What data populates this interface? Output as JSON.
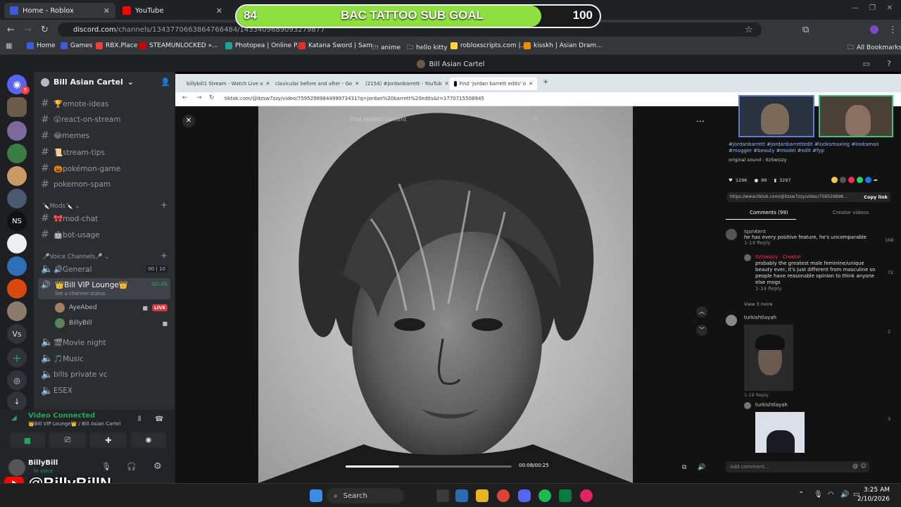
{
  "browser": {
    "tabs": [
      {
        "title": "Home - Roblox",
        "color": "#3b5bdb"
      },
      {
        "title": "YouTube",
        "color": "#ff0000"
      }
    ],
    "url_host": "discord.com",
    "url_path": "/channels/1343770663864766484/1433409689093279877",
    "bookmarks": [
      "Home",
      "Games",
      "RBX.Place",
      "STEAMUNLOCKED »...",
      "Photopea | Online P...",
      "Katana Sword | Sam...",
      "anime",
      "hello kitty",
      "robloxscripts.com |...",
      "kisskh | Asian Dram..."
    ],
    "all_bookmarks": "All Bookmarks"
  },
  "sub_goal": {
    "current": "84",
    "title": "BAC TATTOO SUB GOAL",
    "max": "100",
    "progress": 0.84,
    "color": "#8de040"
  },
  "discord": {
    "window_title": "Bill Asian Cartel",
    "server_name": "Bill Asian Cartel",
    "server_badge": "5",
    "channels": [
      {
        "name": "🏆emote-ideas"
      },
      {
        "name": "😮react-on-stream"
      },
      {
        "name": "😂memes"
      },
      {
        "name": "📜stream-tips"
      },
      {
        "name": "🎃pokémon-game"
      },
      {
        "name": "pokemon-spam"
      }
    ],
    "mods_category": "🔪Mods🔪",
    "mod_channels": [
      {
        "name": "🎀mod-chat"
      },
      {
        "name": "🤖bot-usage"
      }
    ],
    "voice_category": "🎤Voice Channels🎤",
    "voice_channels": {
      "general": "🔊General",
      "general_count_a": "00",
      "general_count_b": "10",
      "vip": "👑Bill VIP Lounge👑",
      "vip_time": "40:46",
      "vip_status": "Set a channel status",
      "users": [
        {
          "name": "AyeAbed",
          "live": "LIVE"
        },
        {
          "name": "BillyBill"
        }
      ],
      "movie": "🎬Movie night",
      "music": "🎵Music",
      "private": "bills private vc",
      "esex": "ESEX"
    },
    "voice_connected": "Video Connected",
    "voice_location": "👑Bill VIP Lounge👑 / Bill Asian Cartel",
    "user": {
      "name": "BillyBill",
      "status": "In voice"
    }
  },
  "stream": {
    "inner_tabs": [
      "billybill1 Stream - Watch Live o",
      "clavicular before and after - Go",
      "(2154) #jordanbarrett - YouTub",
      "Find 'jordan barrett edits' o"
    ],
    "inner_url": "tiktok.com/@itzsw7zzy/video/7595298984499973431?q=jordan%20barrett%20edits&t=1770715508945",
    "search_placeholder": "Find related content",
    "hashtags": "#jordanbarrett #jordanbarrettedit #looksmaxing #looksmax #mogger #beauty #model #edit #fyp",
    "sound": "original sound - ItzSwizzy",
    "likes": "129K",
    "comments_count": "99",
    "saves": "3297",
    "share_url": "https://www.tiktok.com/@itzsw7zzy/video/759529898...",
    "copy_link": "Copy link",
    "tab_comments": "Comments (99)",
    "tab_creator": "Creator videos",
    "comments": [
      {
        "user": "IqonKent",
        "text": "he has every positive feature, he's uncomparable",
        "meta": "1-14   Reply",
        "likes": "168"
      },
      {
        "user": "ItzSwizzy · Creator",
        "text": "probably the greatest male feminine/unique beauty ever, it's just different from masculine so people have reasonable opinion to think anyone else mogs",
        "meta": "1-14   Reply",
        "likes": "72"
      },
      {
        "user": "turkishtlayah",
        "text": "",
        "meta": "1-19   Reply",
        "likes": "2"
      },
      {
        "user": "turkishtlayah",
        "text": "",
        "meta": "",
        "likes": "3"
      }
    ],
    "view_more": "View 3 more",
    "add_comment": "Add comment...",
    "time": "00:08/00:25",
    "video_progress": 0.32
  },
  "taskbar": {
    "search": "Search",
    "time": "3:25 AM",
    "date": "2/10/2026"
  },
  "watermark": "@BillyBillN"
}
